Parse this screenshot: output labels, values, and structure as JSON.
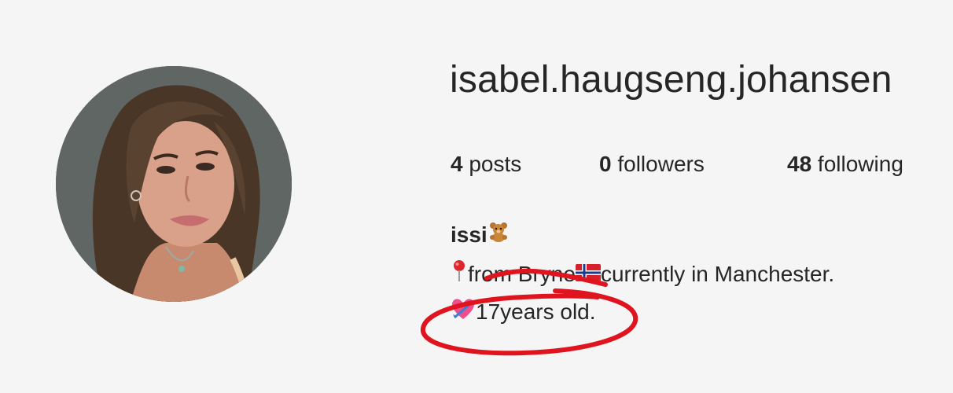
{
  "profile": {
    "username": "isabel.haugseng.johansen",
    "avatar_icon": "profile-photo"
  },
  "stats": {
    "posts_count": "4",
    "posts_label": " posts",
    "followers_count": "0",
    "followers_label": " followers",
    "following_count": "48",
    "following_label": " following"
  },
  "bio": {
    "name": "issi",
    "name_emoji": "teddy-bear-icon",
    "line1_from": "from Bryne",
    "line1_rest": "currently in Manchester.",
    "line2": " 17years old.",
    "line1_icons": [
      "round-pushpin-icon",
      "norway-flag-icon"
    ],
    "line2_icon": "heart-with-arrow-icon"
  },
  "annotation": {
    "color": "#e0141e"
  }
}
